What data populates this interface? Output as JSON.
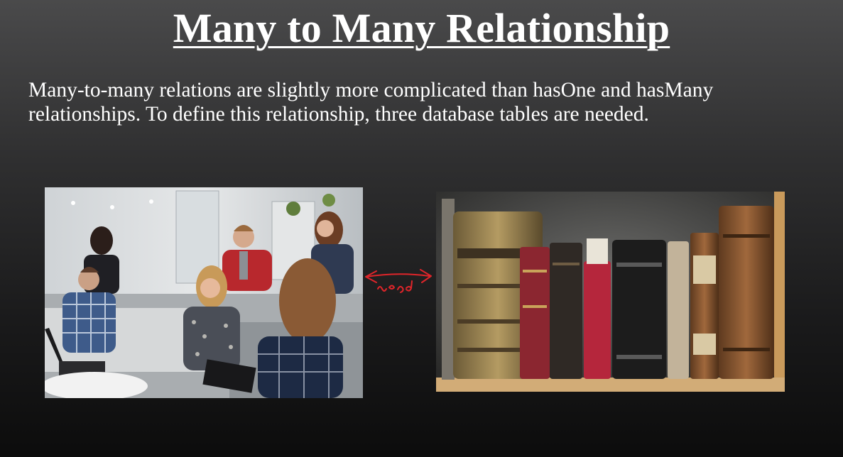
{
  "slide": {
    "title": "Many to Many Relationship",
    "body": "Many-to-many relations are slightly more complicated than hasOne and hasMany relationships. To define this relationship, three database tables are needed."
  },
  "images": {
    "left": {
      "icon": "photo-of-people-meeting-in-office"
    },
    "right": {
      "icon": "photo-of-old-books-on-shelf"
    }
  },
  "annotation": {
    "icon": "red-handwritten-double-arrow",
    "color": "#e0252a"
  },
  "colors": {
    "background_top": "#4a4a4b",
    "background_bottom": "#0c0c0c",
    "text": "#ffffff"
  }
}
